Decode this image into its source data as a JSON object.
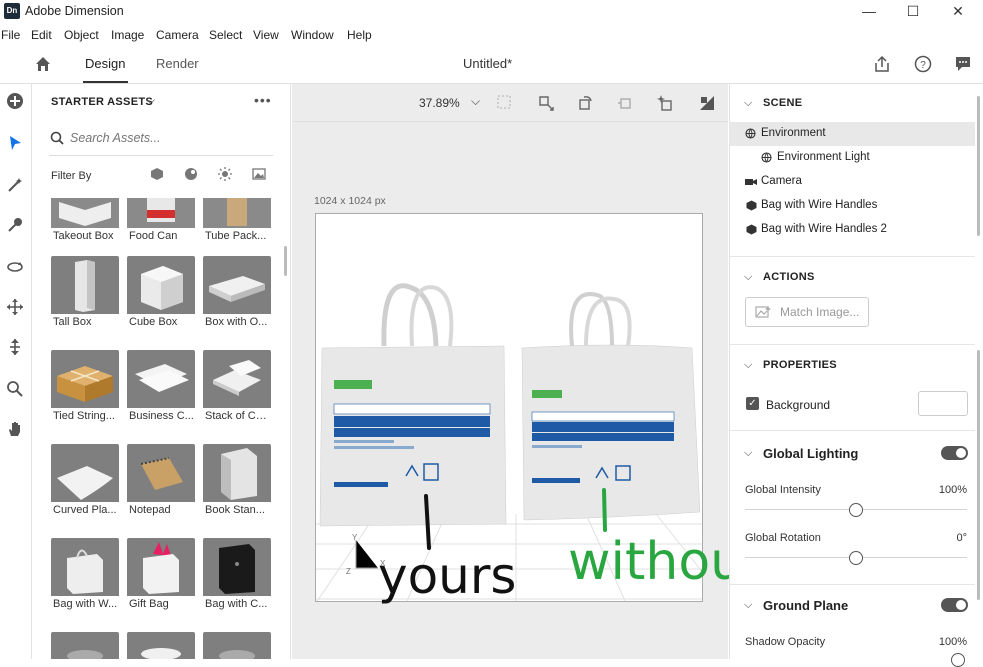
{
  "window": {
    "logo": "Dn",
    "title": "Adobe Dimension",
    "controls": {
      "minimize": "—",
      "maximize": "☐",
      "close": "✕"
    }
  },
  "menu": [
    "File",
    "Edit",
    "Object",
    "Image",
    "Camera",
    "Select",
    "View",
    "Window",
    "Help"
  ],
  "topbar": {
    "home_icon": "home-icon",
    "tabs": [
      "Design",
      "Render"
    ],
    "active_tab": "Design",
    "document_title": "Untitled*",
    "right_icons": [
      "share-icon",
      "help-icon",
      "feedback-icon"
    ]
  },
  "tools": [
    "add-icon",
    "select-icon",
    "magic-wand-icon",
    "sample-icon",
    "orbit-icon",
    "pan-icon",
    "dolly-icon",
    "zoom-icon",
    "hand-icon"
  ],
  "assets": {
    "title": "STARTER ASSETS",
    "search_placeholder": "Search Assets...",
    "filter_label": "Filter By",
    "filter_icons": [
      "model-filter-icon",
      "material-filter-icon",
      "light-filter-icon",
      "image-filter-icon"
    ],
    "items": [
      {
        "label": "Takeout Box"
      },
      {
        "label": "Food Can"
      },
      {
        "label": "Tube Pack..."
      },
      {
        "label": "Tall Box"
      },
      {
        "label": "Cube Box"
      },
      {
        "label": "Box with O..."
      },
      {
        "label": "Tied String..."
      },
      {
        "label": "Business C..."
      },
      {
        "label": "Stack of Ca..."
      },
      {
        "label": "Curved Pla..."
      },
      {
        "label": "Notepad"
      },
      {
        "label": "Book Stan..."
      },
      {
        "label": "Bag with W..."
      },
      {
        "label": "Gift Bag"
      },
      {
        "label": "Bag with C..."
      },
      {
        "label": ""
      },
      {
        "label": ""
      },
      {
        "label": ""
      }
    ]
  },
  "canvas": {
    "zoom": "37.89%",
    "size_label": "1024 x 1024 px",
    "annotation_left": "yours",
    "annotation_right": "without",
    "annotation_left_color": "#111111",
    "annotation_right_color": "#2aa640",
    "bag_left": {
      "tag": "Vitamin B",
      "table_header": [
        "Active ingredient",
        "Amount",
        "%RI*"
      ],
      "table_row1": [
        "Streptococcus salivarius K12",
        "1x10⁹ cfu",
        "-"
      ],
      "table_row2": [
        "Vitamin B",
        "5 µg",
        "100%"
      ],
      "footnote": "*RI = Reference intake",
      "weight": "Net weight: 26.5g ℮"
    },
    "bag_right": {
      "tag": "Vitamin B",
      "weight": "Net weight: 28 g ℮"
    }
  },
  "scene": {
    "title": "SCENE",
    "items": [
      {
        "label": "Environment",
        "icon": "globe-icon",
        "indent": 0,
        "selected": true
      },
      {
        "label": "Environment Light",
        "icon": "globe-icon",
        "indent": 1,
        "selected": false
      },
      {
        "label": "Camera",
        "icon": "camera-icon",
        "indent": 0,
        "selected": false
      },
      {
        "label": "Bag with Wire Handles",
        "icon": "model-icon",
        "indent": 0,
        "selected": false
      },
      {
        "label": "Bag with Wire Handles 2",
        "icon": "model-icon",
        "indent": 0,
        "selected": false
      }
    ]
  },
  "actions": {
    "title": "ACTIONS",
    "match_image": "Match Image..."
  },
  "properties": {
    "title": "PROPERTIES",
    "background_label": "Background",
    "background_checked": true,
    "background_color": "#ffffff",
    "global_lighting": {
      "label": "Global Lighting",
      "enabled": true,
      "intensity_label": "Global Intensity",
      "intensity_value": "100%",
      "intensity_fraction": 0.5,
      "rotation_label": "Global Rotation",
      "rotation_value": "0°",
      "rotation_fraction": 0.5
    },
    "ground_plane": {
      "label": "Ground Plane",
      "enabled": true,
      "shadow_label": "Shadow Opacity",
      "shadow_value": "100%"
    }
  }
}
